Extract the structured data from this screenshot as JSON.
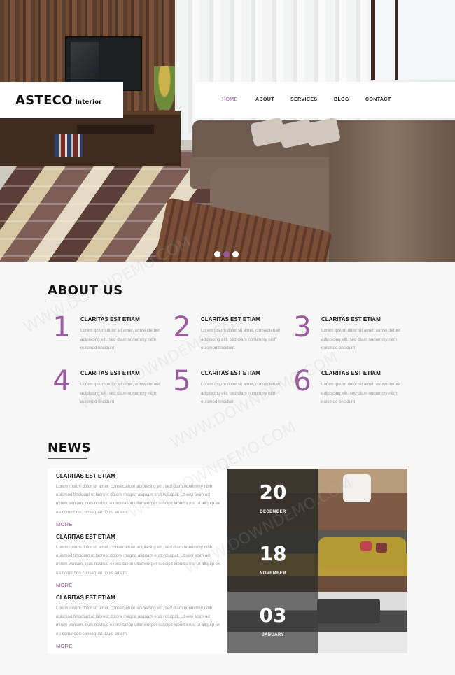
{
  "brand": {
    "name": "ASTECO",
    "tagline": "Interior"
  },
  "nav": {
    "items": [
      {
        "label": "HOME",
        "active": true
      },
      {
        "label": "ABOUT",
        "active": false
      },
      {
        "label": "SERVICES",
        "active": false
      },
      {
        "label": "BLOG",
        "active": false
      },
      {
        "label": "CONTACT",
        "active": false
      }
    ]
  },
  "slider": {
    "dots": 3,
    "active_index": 1
  },
  "about": {
    "title": "ABOUT US",
    "items": [
      {
        "number": "1",
        "heading": "CLARITAS EST ETIAM",
        "text": "Lorem ipsum dolor sit amet, consectetuer adipiscing elit, sed diam nonummy nibh euismod tincidunt"
      },
      {
        "number": "2",
        "heading": "CLARITAS EST ETIAM",
        "text": "Lorem ipsum dolor sit amet, consectetuer adipiscing elit, sed diam nonummy nibh euismod tincidunt"
      },
      {
        "number": "3",
        "heading": "CLARITAS EST ETIAM",
        "text": "Lorem ipsum dolor sit amet, consectetuer adipiscing elit, sed diam nonummy nibh euismod tincidunt"
      },
      {
        "number": "4",
        "heading": "CLARITAS EST ETIAM",
        "text": "Lorem ipsum dolor sit amet, consectetuer adipiscing elit, sed diam nonummy nibh euismod tincidunt"
      },
      {
        "number": "5",
        "heading": "CLARITAS EST ETIAM",
        "text": "Lorem ipsum dolor sit amet, consectetuer adipiscing elit, sed diam nonummy nibh euismod tincidunt"
      },
      {
        "number": "6",
        "heading": "CLARITAS EST ETIAM",
        "text": "Lorem ipsum dolor sit amet, consectetuer adipiscing elit, sed diam nonummy nibh euismod tincidunt"
      }
    ]
  },
  "news": {
    "title": "NEWS",
    "items": [
      {
        "heading": "CLARITAS EST ETIAM",
        "text": "Lorem ipsum dolor sit amet, consectetuer adipiscing elit, sed diam nonummy nibh euismod tincidunt ut laoreet dolore magna aliquam erat volutpat. Ut wisi enim ad minim veniam, quis nostrud exerci tation ullamcorper suscipit lobortis nisl ut aliquip ex ea commodo consequat. Duis autem",
        "more": "MORE",
        "day": "20",
        "month": "DECEMBER"
      },
      {
        "heading": "CLARITAS EST ETIAM",
        "text": "Lorem ipsum dolor sit amet, consectetuer adipiscing elit, sed diam nonummy nibh euismod tincidunt ut laoreet dolore magna aliquam erat volutpat. Ut wisi enim ad minim veniam, quis nostrud exerci tation ullamcorper suscipit lobortis nisl ut aliquip ex ea commodo consequat. Duis autem",
        "more": "MORE",
        "day": "18",
        "month": "NOVEMBER"
      },
      {
        "heading": "CLARITAS EST ETIAM",
        "text": "Lorem ipsum dolor sit amet, consectetuer adipiscing elit, sed diam nonummy nibh euismod tincidunt ut laoreet dolore magna aliquam erat volutpat. Ut wisi enim ad minim veniam, quis nostrud exerci tation ullamcorper suscipit lobortis nisl ut aliquip ex ea commodo consequat. Duis autem",
        "more": "MORE",
        "day": "03",
        "month": "JANUARY"
      }
    ]
  },
  "watermark": "WWW.DOWNDEMO.COM",
  "colors": {
    "accent": "#9b5aa0",
    "text": "#111111",
    "muted": "#9a9a9a",
    "background": "#f7f7f7"
  }
}
